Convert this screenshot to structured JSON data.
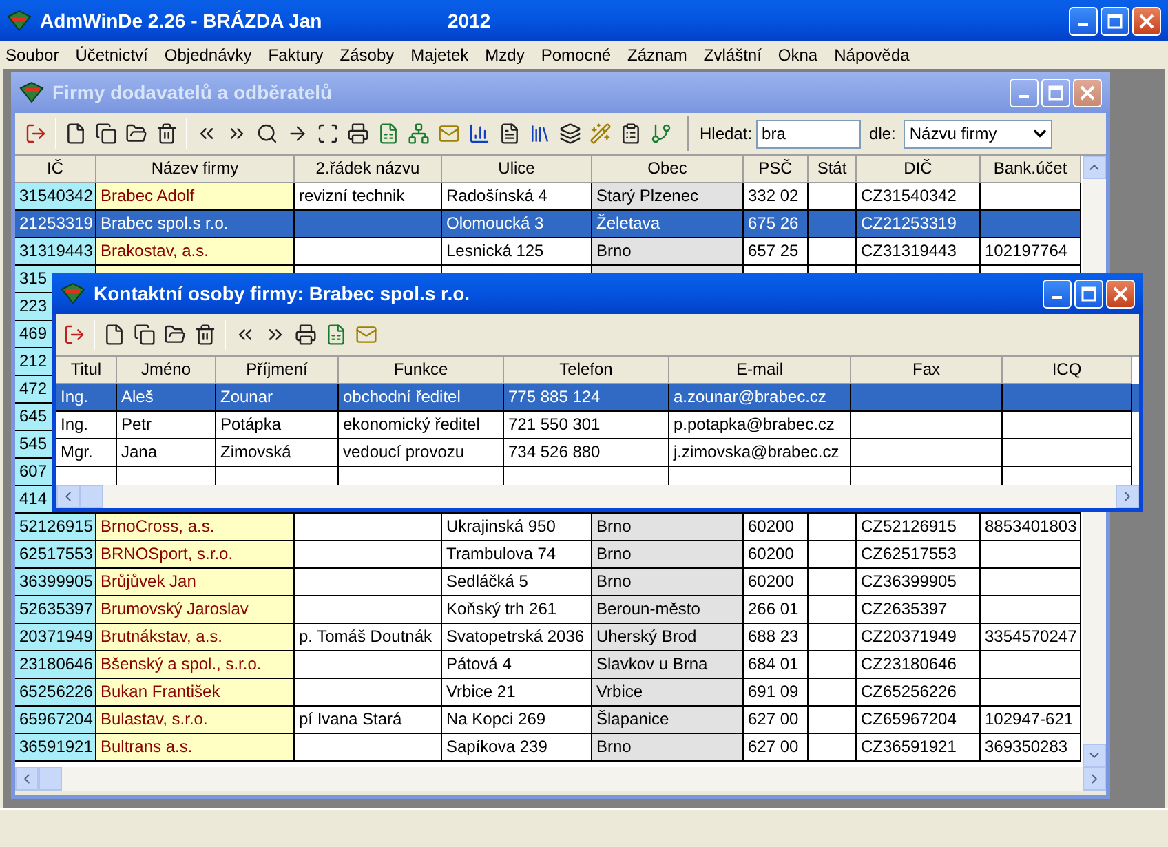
{
  "window": {
    "title": "AdmWinDe 2.26 - BRÁZDA Jan",
    "year": "2012"
  },
  "menu": [
    "Soubor",
    "Účetnictví",
    "Objednávky",
    "Faktury",
    "Zásoby",
    "Majetek",
    "Mzdy",
    "Pomocné",
    "Záznam",
    "Zvláštní",
    "Okna",
    "Nápověda"
  ],
  "companies_window": {
    "title": "Firmy dodavatelů a odběratelů",
    "search": {
      "label": "Hledat:",
      "value": "bra"
    },
    "sort": {
      "label": "dle:",
      "value": "Názvu firmy"
    },
    "table": {
      "columns": [
        "IČ",
        "Název firmy",
        "2.řádek názvu",
        "Ulice",
        "Obec",
        "PSČ",
        "Stát",
        "DIČ",
        "Bank.účet"
      ],
      "rows": [
        {
          "selected": false,
          "cells": [
            "31540342",
            "Brabec Adolf",
            "revizní technik",
            "Radošínská 4",
            "Starý Plzenec",
            "332 02",
            "",
            "CZ31540342",
            ""
          ]
        },
        {
          "selected": true,
          "cells": [
            "21253319",
            "Brabec spol.s r.o.",
            "",
            "Olomoucká 3",
            "Želetava",
            "675 26",
            "",
            "CZ21253319",
            ""
          ]
        },
        {
          "selected": false,
          "cells": [
            "31319443",
            "Brakostav, a.s.",
            "",
            "Lesnická 125",
            "Brno",
            "657 25",
            "",
            "CZ31319443",
            "102197764"
          ]
        },
        {
          "selected": false,
          "cells": [
            "315"
          ]
        },
        {
          "selected": false,
          "cells": [
            "223"
          ]
        },
        {
          "selected": false,
          "cells": [
            "469"
          ]
        },
        {
          "selected": false,
          "cells": [
            "212"
          ]
        },
        {
          "selected": false,
          "cells": [
            "472"
          ]
        },
        {
          "selected": false,
          "cells": [
            "645"
          ]
        },
        {
          "selected": false,
          "cells": [
            "545"
          ]
        },
        {
          "selected": false,
          "cells": [
            "607"
          ]
        },
        {
          "selected": false,
          "cells": [
            "414"
          ]
        },
        {
          "selected": false,
          "cells": [
            "52126915",
            "BrnoCross, a.s.",
            "",
            "Ukrajinská 950",
            "Brno",
            "60200",
            "",
            "CZ52126915",
            "8853401803"
          ]
        },
        {
          "selected": false,
          "cells": [
            "62517553",
            "BRNOSport, s.r.o.",
            "",
            "Trambulova 74",
            "Brno",
            "60200",
            "",
            "CZ62517553",
            ""
          ]
        },
        {
          "selected": false,
          "cells": [
            "36399905",
            "Brůjůvek Jan",
            "",
            "Sedláčká 5",
            "Brno",
            "60200",
            "",
            "CZ36399905",
            ""
          ]
        },
        {
          "selected": false,
          "cells": [
            "52635397",
            "Brumovský Jaroslav",
            "",
            "Koňský trh 261",
            "Beroun-město",
            "266 01",
            "",
            "CZ2635397",
            ""
          ]
        },
        {
          "selected": false,
          "cells": [
            "20371949",
            "Brutnákstav, a.s.",
            "p. Tomáš Doutnák",
            "Svatopetrská 2036",
            "Uherský Brod",
            "688 23",
            "",
            "CZ20371949",
            "3354570247"
          ]
        },
        {
          "selected": false,
          "cells": [
            "23180646",
            "Bšenský a spol., s.r.o.",
            "",
            "Pátová 4",
            "Slavkov u Brna",
            "684 01",
            "",
            "CZ23180646",
            ""
          ]
        },
        {
          "selected": false,
          "cells": [
            "65256226",
            "Bukan František",
            "",
            "Vrbice 21",
            "Vrbice",
            "691 09",
            "",
            "CZ65256226",
            ""
          ]
        },
        {
          "selected": false,
          "cells": [
            "65967204",
            "Bulastav, s.r.o.",
            "pí Ivana Stará",
            "Na Kopci 269",
            "Šlapanice",
            "627 00",
            "",
            "CZ65967204",
            "102947-621"
          ]
        },
        {
          "selected": false,
          "cells": [
            "36591921",
            "Bultrans a.s.",
            "",
            "Sapíkova 239",
            "Brno",
            "627 00",
            "",
            "CZ36591921",
            "369350283"
          ]
        }
      ]
    }
  },
  "contacts_window": {
    "title": "Kontaktní osoby firmy: Brabec spol.s r.o.",
    "table": {
      "columns": [
        "Titul",
        "Jméno",
        "Příjmení",
        "Funkce",
        "Telefon",
        "E-mail",
        "Fax",
        "ICQ"
      ],
      "rows": [
        {
          "selected": true,
          "cells": [
            "Ing.",
            "Aleš",
            "Zounar",
            "obchodní ředitel",
            "775 885 124",
            "a.zounar@brabec.cz",
            "",
            ""
          ]
        },
        {
          "selected": false,
          "cells": [
            "Ing.",
            "Petr",
            "Potápka",
            "ekonomický ředitel",
            "721 550 301",
            "p.potapka@brabec.cz",
            "",
            ""
          ]
        },
        {
          "selected": false,
          "cells": [
            "Mgr.",
            "Jana",
            "Zimovská",
            "vedoucí provozu",
            "734 526 880",
            "j.zimovska@brabec.cz",
            "",
            ""
          ]
        }
      ]
    }
  }
}
